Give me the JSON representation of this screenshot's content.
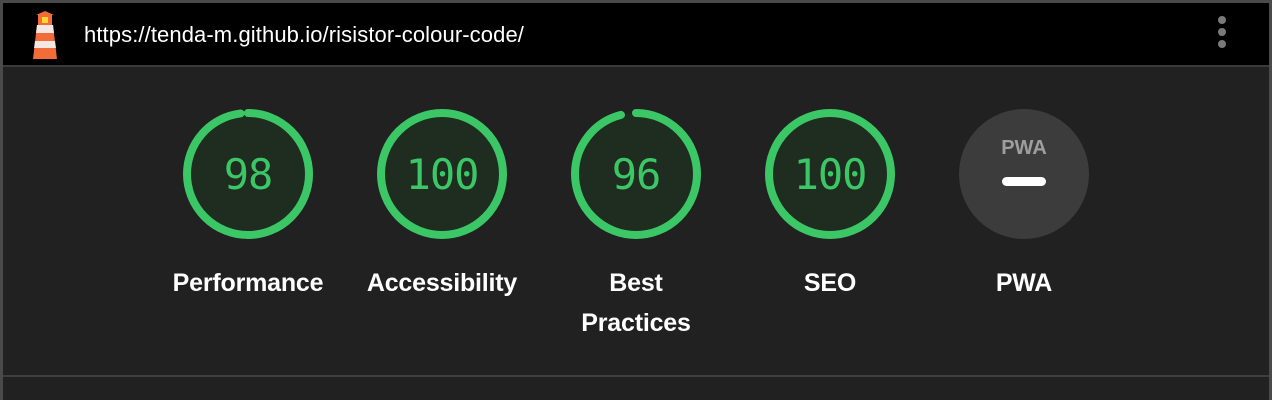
{
  "report": {
    "url": "https://tenda-m.github.io/risistor-colour-code/"
  },
  "colors": {
    "pass": "#3cc766",
    "gauge_fill": "#1f2d21",
    "pwa_bg": "#3c3c3c"
  },
  "categories": [
    {
      "id": "performance",
      "label": "Performance",
      "score": "98",
      "fraction": 0.98
    },
    {
      "id": "accessibility",
      "label": "Accessibility",
      "score": "100",
      "fraction": 1.0
    },
    {
      "id": "best-practices",
      "label": "Best Practices",
      "score": "96",
      "fraction": 0.96
    },
    {
      "id": "seo",
      "label": "SEO",
      "score": "100",
      "fraction": 1.0
    }
  ],
  "pwa": {
    "label": "PWA",
    "badge_text": "PWA"
  }
}
